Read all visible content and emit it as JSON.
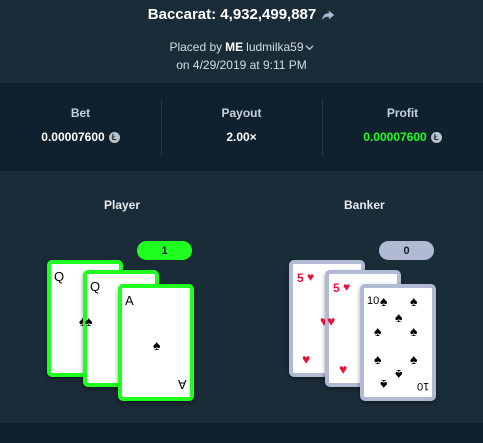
{
  "header": {
    "title": "Baccarat: 4,932,499,887",
    "placed_prefix": "Placed by",
    "me_label": "ME",
    "username": "ludmilka59",
    "date": "on 4/29/2019 at 9:11 PM"
  },
  "stats": {
    "bet_label": "Bet",
    "bet_value": "0.00007600",
    "payout_label": "Payout",
    "payout_value": "2.00×",
    "profit_label": "Profit",
    "profit_value": "0.00007600"
  },
  "player": {
    "label": "Player",
    "score": "1",
    "cards": [
      {
        "rank": "Q",
        "suit": "spade"
      },
      {
        "rank": "Q",
        "suit": "spade"
      },
      {
        "rank": "A",
        "suit": "spade"
      }
    ]
  },
  "banker": {
    "label": "Banker",
    "score": "0",
    "cards": [
      {
        "rank": "5",
        "suit": "heart"
      },
      {
        "rank": "5",
        "suit": "heart"
      },
      {
        "rank": "10",
        "suit": "spade"
      }
    ]
  },
  "colors": {
    "background": "#1a2c38",
    "panel": "#0f212e",
    "win_green": "#1fff20",
    "neutral_badge": "#b1bad3",
    "heart_red": "#e9113c"
  },
  "icons": {
    "share": "share-arrow-icon",
    "chevron": "chevron-down-icon",
    "currency": "litecoin-icon"
  }
}
